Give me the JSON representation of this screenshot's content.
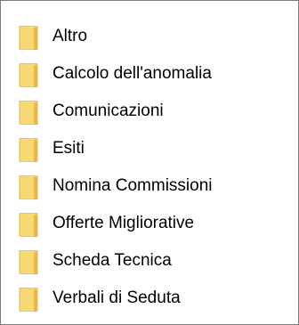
{
  "folders": [
    {
      "label": "Altro",
      "icon": "folder-icon"
    },
    {
      "label": "Calcolo dell'anomalia",
      "icon": "folder-icon"
    },
    {
      "label": "Comunicazioni",
      "icon": "folder-icon"
    },
    {
      "label": "Esiti",
      "icon": "folder-icon"
    },
    {
      "label": "Nomina Commissioni",
      "icon": "folder-icon"
    },
    {
      "label": "Offerte Migliorative",
      "icon": "folder-icon"
    },
    {
      "label": "Scheda Tecnica",
      "icon": "folder-icon"
    },
    {
      "label": "Verbali di Seduta",
      "icon": "folder-icon"
    }
  ],
  "colors": {
    "folder_fill": "#f8d775",
    "folder_tab": "#e8b84a",
    "folder_shadow": "#dcae3c",
    "border": "#7a7a7a"
  }
}
